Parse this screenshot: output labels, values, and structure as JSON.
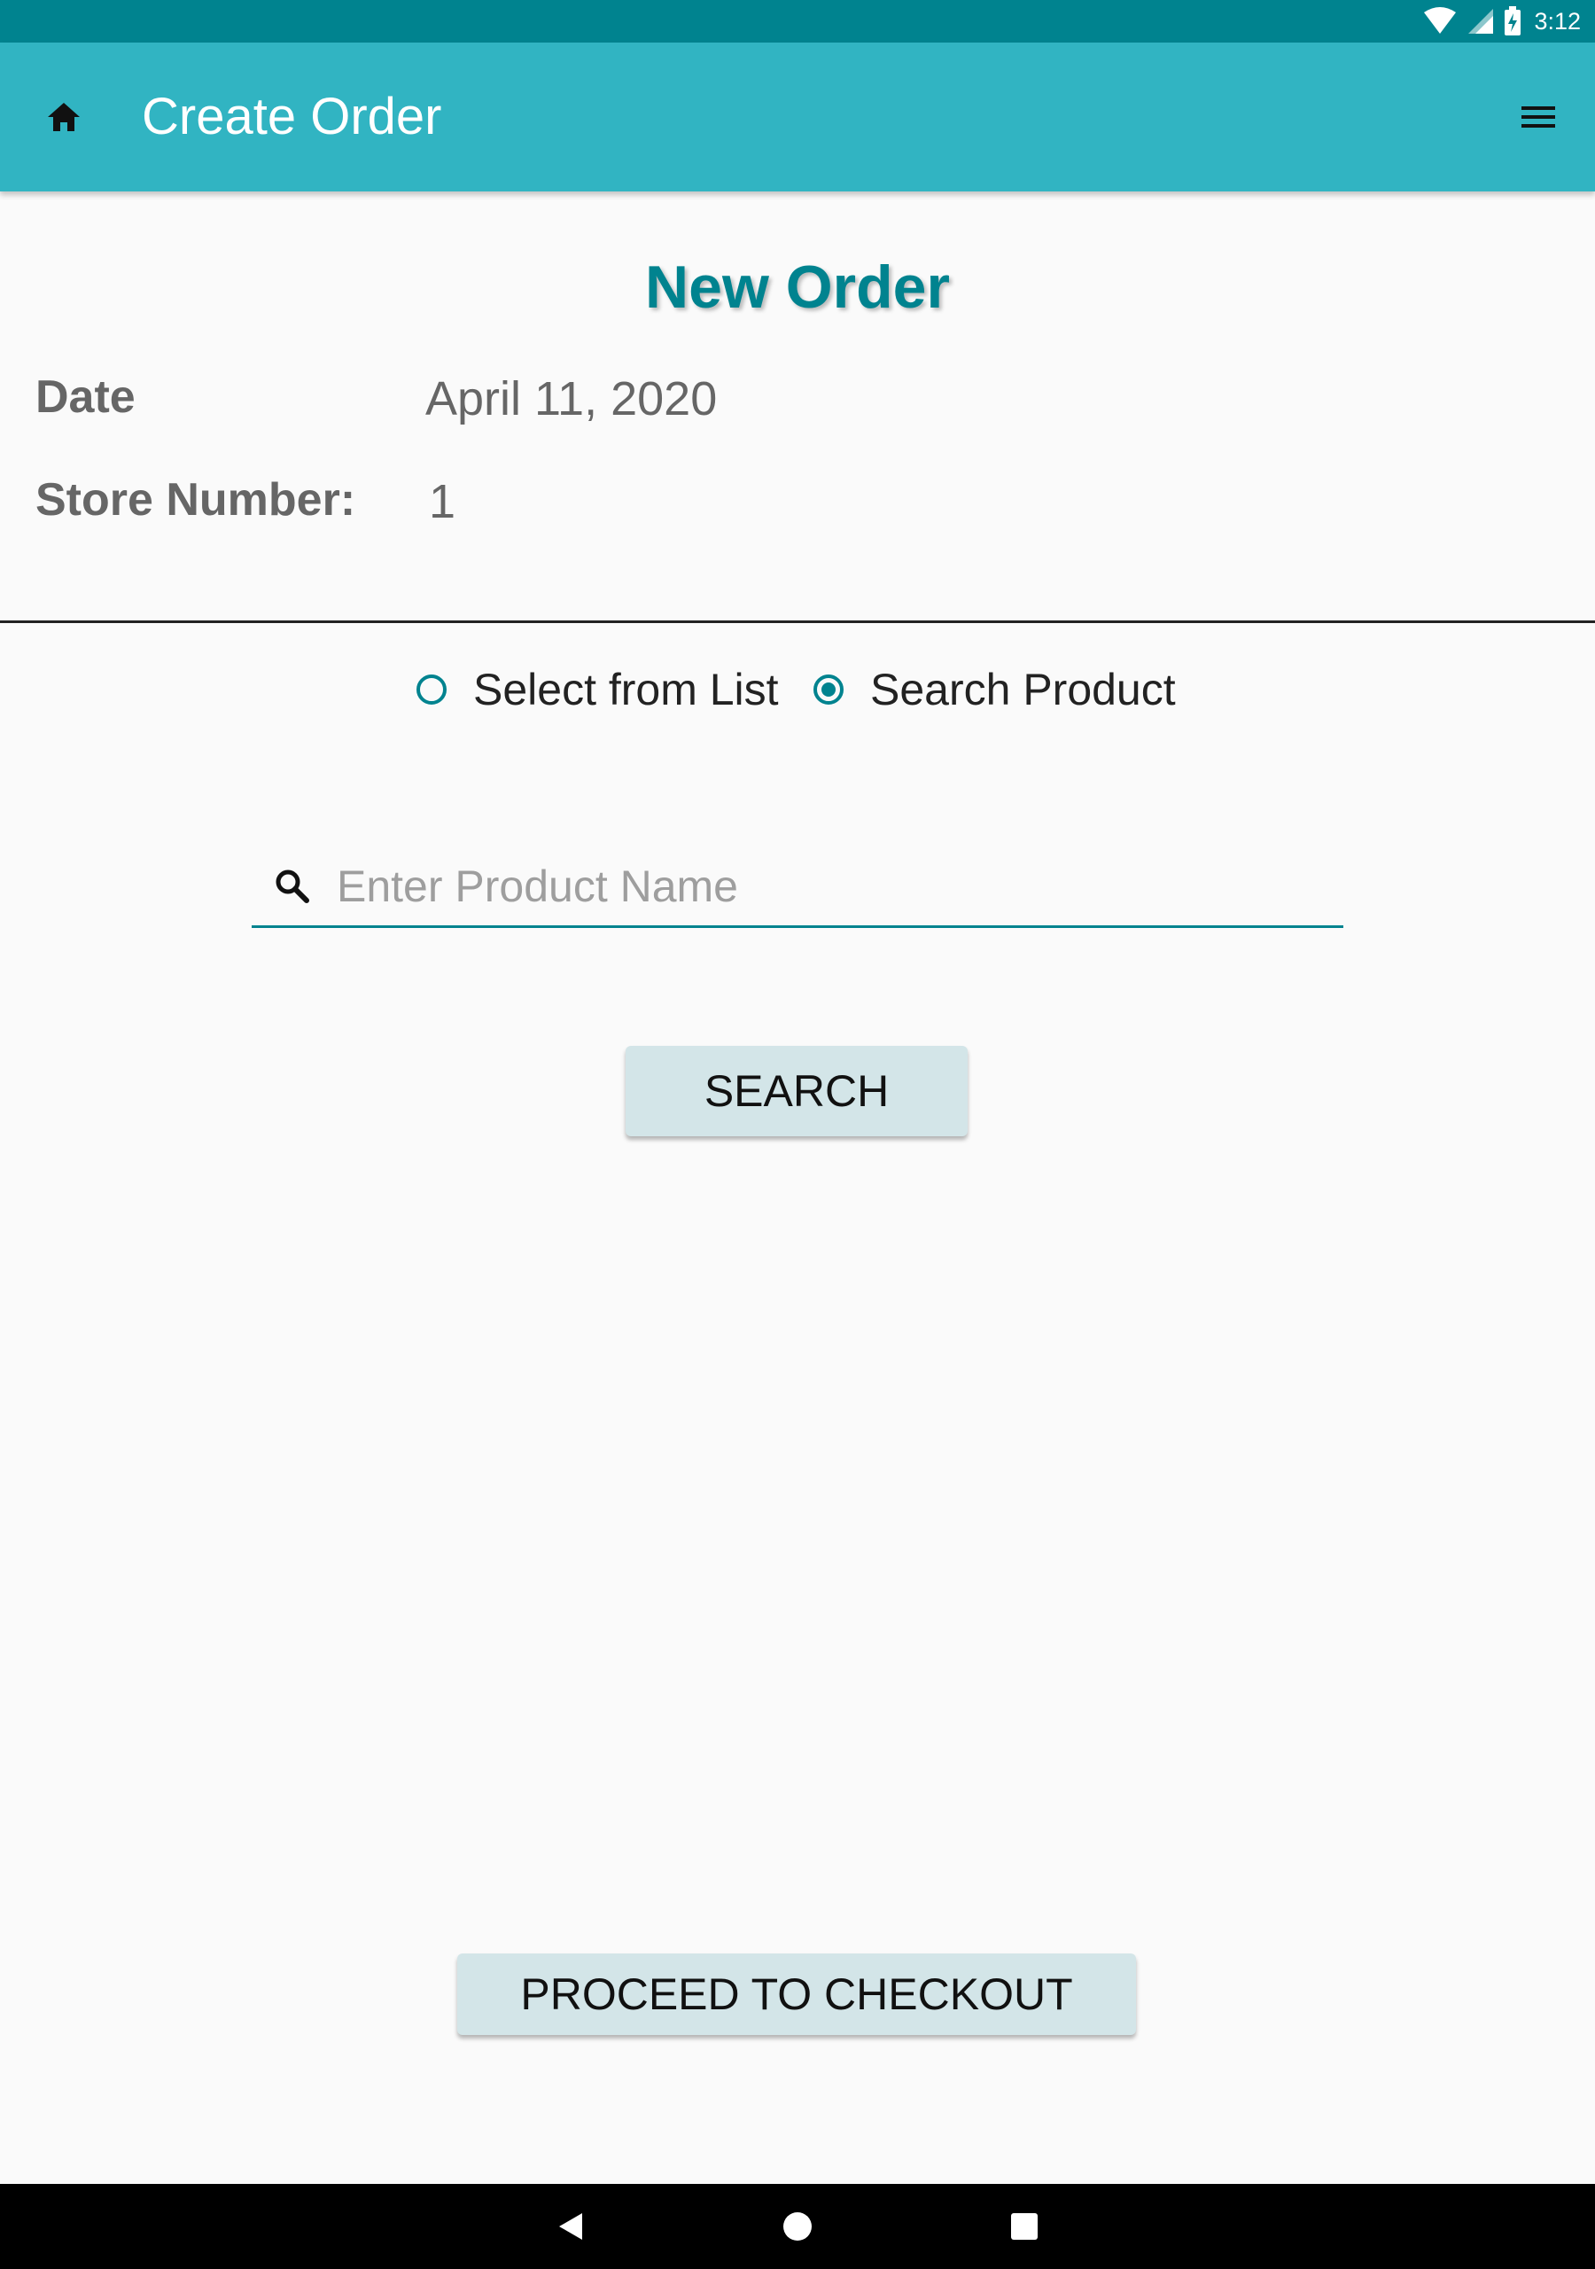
{
  "status_bar": {
    "time": "3:12",
    "icons": [
      "wifi-icon",
      "signal-icon",
      "battery-charging-icon"
    ]
  },
  "app_bar": {
    "title": "Create Order",
    "left_icon": "home-icon",
    "right_icon": "menu-icon",
    "background": "#31b4c2"
  },
  "order": {
    "heading": "New Order",
    "date_label": "Date",
    "date_value": "April 11, 2020",
    "store_label": "Store Number:",
    "store_value": "1"
  },
  "mode": {
    "options": [
      {
        "label": "Select from List",
        "checked": false
      },
      {
        "label": "Search Product",
        "checked": true
      }
    ]
  },
  "search": {
    "placeholder": "Enter Product Name",
    "value": "",
    "icon": "search-icon",
    "button_label": "SEARCH"
  },
  "footer": {
    "checkout_label": "PROCEED TO CHECKOUT"
  },
  "nav_bar": {
    "icons": [
      "back-icon",
      "home-circle-icon",
      "recents-icon"
    ]
  },
  "colors": {
    "accent": "#00838f",
    "status_bar": "#00838f",
    "button": "#d3e5e8"
  }
}
